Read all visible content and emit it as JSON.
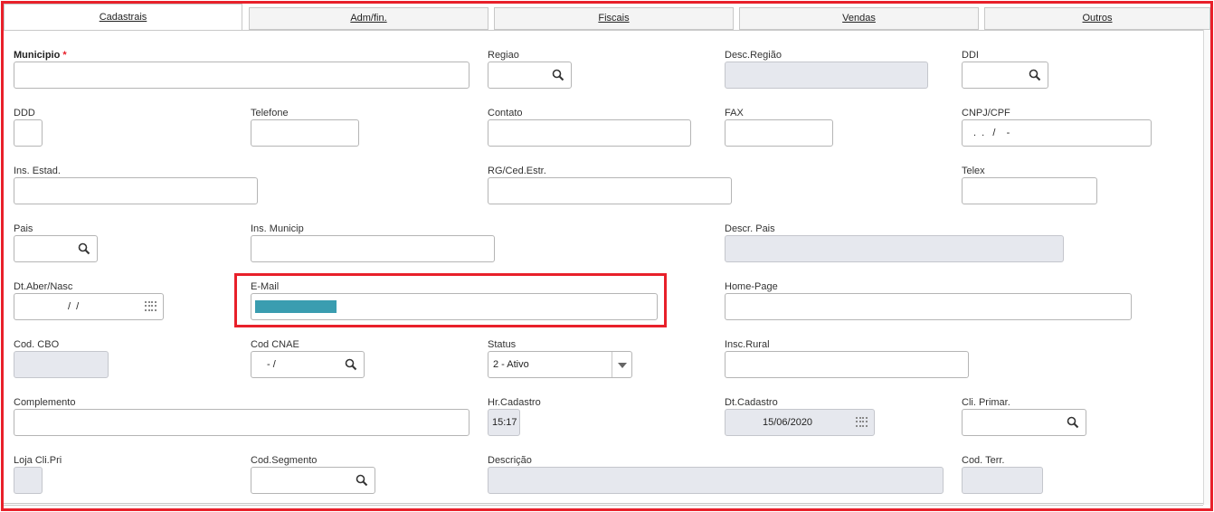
{
  "tabs": [
    {
      "label": "Cadastrais",
      "active": true
    },
    {
      "label": "Adm/fin."
    },
    {
      "label": "Fiscais"
    },
    {
      "label": "Vendas"
    },
    {
      "label": "Outros"
    }
  ],
  "colors": {
    "highlight": "#e8202a",
    "selection": "#3a9db0",
    "disabled_bg": "#e6e8ee"
  },
  "fields": {
    "municipio": {
      "label": "Municipio",
      "required_mark": "*"
    },
    "regiao": {
      "label": "Regiao",
      "icon": "search-icon"
    },
    "desc_regiao": {
      "label": "Desc.Região"
    },
    "ddi": {
      "label": "DDI",
      "icon": "search-icon"
    },
    "ddd": {
      "label": "DDD"
    },
    "telefone": {
      "label": "Telefone"
    },
    "contato": {
      "label": "Contato"
    },
    "fax": {
      "label": "FAX"
    },
    "cnpj": {
      "label": "CNPJ/CPF",
      "value": ".  .   /    -"
    },
    "ins_estad": {
      "label": "Ins. Estad."
    },
    "rg": {
      "label": "RG/Ced.Estr."
    },
    "telex": {
      "label": "Telex"
    },
    "pais": {
      "label": "Pais",
      "icon": "search-icon"
    },
    "ins_municip": {
      "label": "Ins. Municip"
    },
    "descr_pais": {
      "label": "Descr. Pais"
    },
    "dt_aber": {
      "label": "Dt.Aber/Nasc",
      "value": "/  /",
      "icon": "calendar-icon"
    },
    "email": {
      "label": "E-Mail"
    },
    "home_page": {
      "label": "Home-Page"
    },
    "cod_cbo": {
      "label": "Cod. CBO"
    },
    "cod_cnae": {
      "label": "Cod CNAE",
      "value": "- /",
      "icon": "search-icon"
    },
    "status": {
      "label": "Status",
      "value": "2 - Ativo"
    },
    "insc_rural": {
      "label": "Insc.Rural"
    },
    "complemento": {
      "label": "Complemento"
    },
    "hr_cadastro": {
      "label": "Hr.Cadastro",
      "value": "15:17"
    },
    "dt_cadastro": {
      "label": "Dt.Cadastro",
      "value": "15/06/2020",
      "icon": "calendar-icon"
    },
    "cli_primar": {
      "label": "Cli. Primar.",
      "icon": "search-icon"
    },
    "loja_cli_pri": {
      "label": "Loja Cli.Pri"
    },
    "cod_segmento": {
      "label": "Cod.Segmento",
      "icon": "search-icon"
    },
    "descricao": {
      "label": "Descrição"
    },
    "cod_terr": {
      "label": "Cod. Terr."
    }
  }
}
